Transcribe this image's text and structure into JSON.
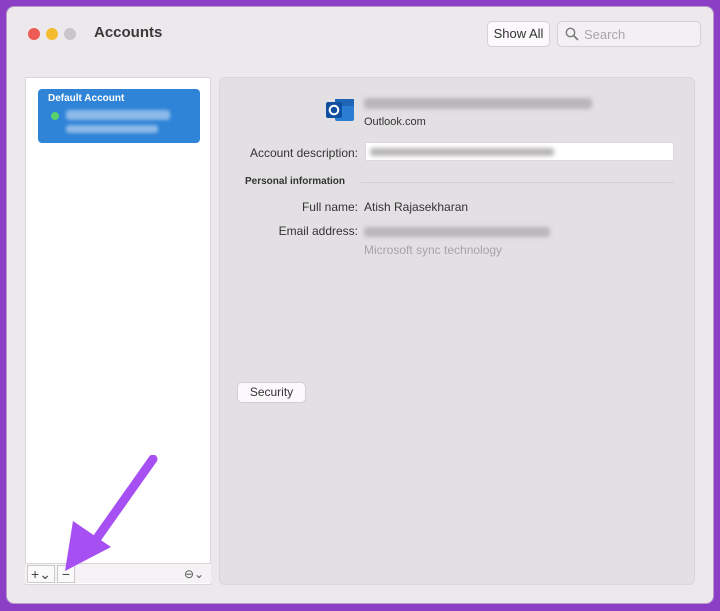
{
  "window": {
    "title": "Accounts",
    "show_all_label": "Show All"
  },
  "search": {
    "placeholder": "Search"
  },
  "sidebar": {
    "accounts": [
      {
        "label": "Default Account",
        "status": "online"
      }
    ],
    "toolbar": {
      "add": "+⌄",
      "remove": "−",
      "action": "⊖⌄"
    }
  },
  "detail": {
    "provider": "Outlook.com",
    "account_description_label": "Account description:",
    "personal_info_heading": "Personal information",
    "full_name_label": "Full name:",
    "full_name_value": "Atish Rajasekharan",
    "email_label": "Email address:",
    "sync_note": "Microsoft sync technology",
    "security_button": "Security"
  },
  "colors": {
    "background": "#8b3fc4",
    "selection": "#2f84d8",
    "annotation_arrow": "#a64ff2"
  }
}
